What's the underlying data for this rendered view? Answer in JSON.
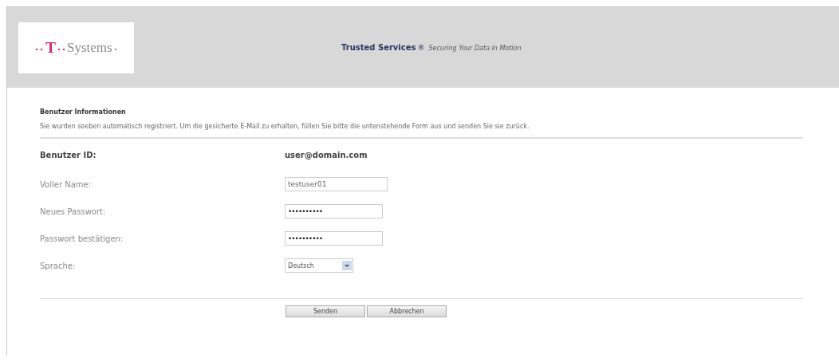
{
  "header": {
    "logo": {
      "mark": "T",
      "name": "Systems"
    },
    "title": "Trusted Services",
    "title_mark": "®",
    "tagline": "Securing Your Data in Motion"
  },
  "section": {
    "title": "Benutzer Informationen",
    "text": "Sie wurden soeben automatisch registriert.  Um die gesicherte E-Mail zu erhalten, füllen Sie bitte die untenstehende Form aus und senden Sie sie zurück."
  },
  "user_id": {
    "label": "Benutzer ID:",
    "value": "user@domain.com"
  },
  "fields": [
    {
      "kind": "text",
      "label": "Voller Name:",
      "value": "testuser01"
    },
    {
      "kind": "password",
      "label": "Neues Passwort:",
      "value": "••••••••••"
    },
    {
      "kind": "password",
      "label": "Passwort bestätigen:",
      "value": "••••••••••"
    },
    {
      "kind": "select",
      "label": "Sprache:",
      "value": "Deutsch"
    }
  ],
  "buttons": [
    "Senden",
    "Abbrechen"
  ]
}
